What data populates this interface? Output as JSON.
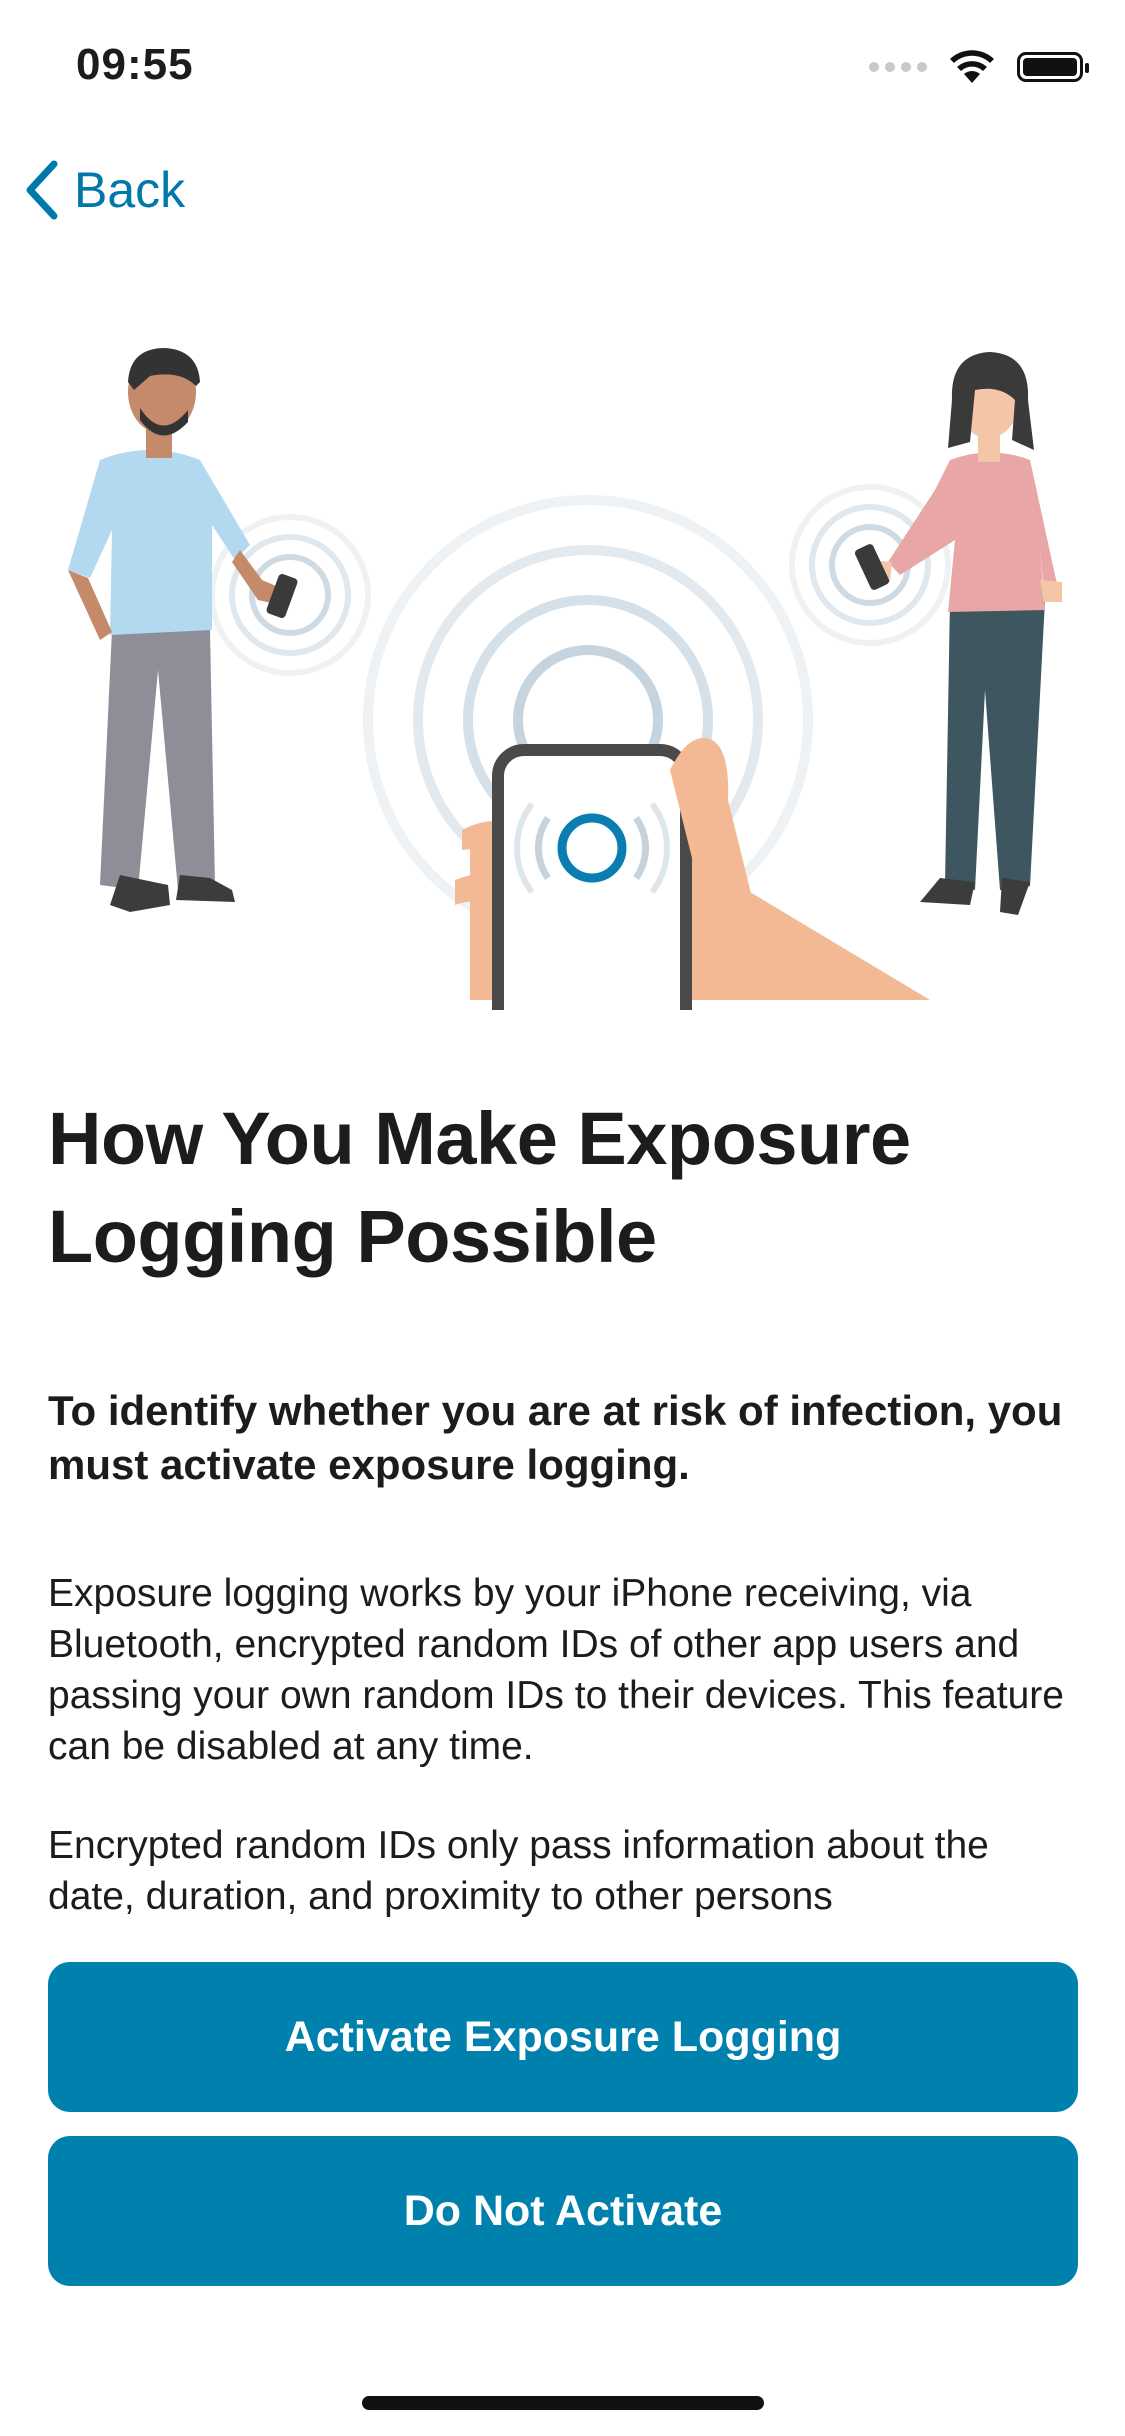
{
  "status_bar": {
    "time": "09:55"
  },
  "nav": {
    "back_label": "Back"
  },
  "content": {
    "title": "How You Make Exposure Logging Possible",
    "lead": "To identify whether you are at risk of infection, you must activate exposure logging.",
    "paragraph1": "Exposure logging works by your iPhone receiving, via Bluetooth, encrypted random IDs of other app users and passing your own random IDs to their devices. This feature can be disabled at any time.",
    "paragraph2": "Encrypted random IDs only pass information about the date, duration, and proximity to other persons"
  },
  "buttons": {
    "activate": "Activate Exposure Logging",
    "decline": "Do Not Activate"
  },
  "colors": {
    "accent": "#0080ad",
    "link": "#0078aa"
  }
}
